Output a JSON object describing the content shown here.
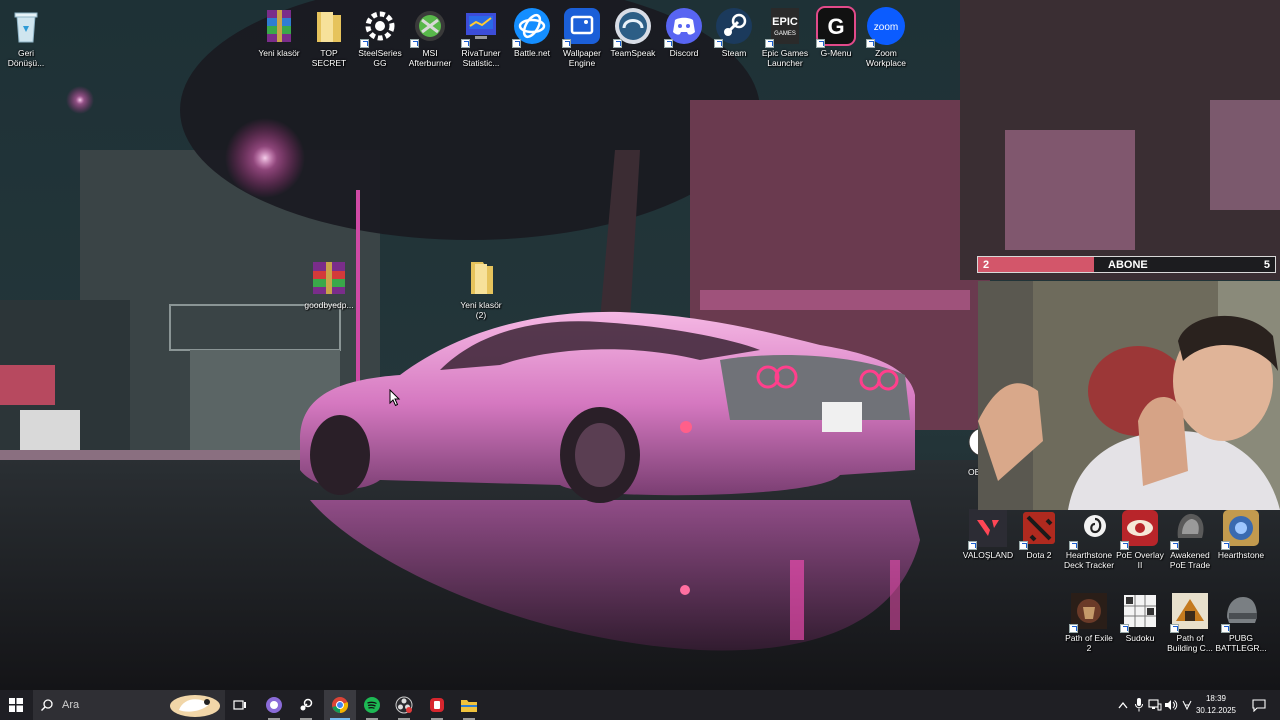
{
  "desktop": {
    "top_icons": [
      {
        "label": "Yeni klasör",
        "icon": "winrar-icon",
        "shortcut": false
      },
      {
        "label": "TOP SECRET",
        "icon": "folder-icon",
        "shortcut": false
      },
      {
        "label": "SteelSeries GG",
        "icon": "steelseries-icon",
        "shortcut": true
      },
      {
        "label": "MSI Afterburner",
        "icon": "afterburner-icon",
        "shortcut": true
      },
      {
        "label": "RivaTuner Statistic...",
        "icon": "rivatuner-icon",
        "shortcut": true
      },
      {
        "label": "Battle.net",
        "icon": "battlenet-icon",
        "shortcut": true
      },
      {
        "label": "Wallpaper Engine",
        "icon": "wallpaper-engine-icon",
        "shortcut": true
      },
      {
        "label": "TeamSpeak",
        "icon": "teamspeak-icon",
        "shortcut": true
      },
      {
        "label": "Discord",
        "icon": "discord-icon",
        "shortcut": true
      },
      {
        "label": "Steam",
        "icon": "steam-icon",
        "shortcut": true
      },
      {
        "label": "Epic Games Launcher",
        "icon": "epic-games-icon",
        "shortcut": true
      },
      {
        "label": "G-Menu",
        "icon": "g-menu-icon",
        "shortcut": true
      },
      {
        "label": "Zoom Workplace",
        "icon": "zoom-icon",
        "shortcut": true
      }
    ],
    "recycle_bin": {
      "label": "Geri Dönüşü...",
      "icon": "recycle-bin-icon"
    },
    "mid_icons": [
      {
        "label": "goodbyedp...",
        "icon": "winrar-icon"
      },
      {
        "label": "Yeni klasör (2)",
        "icon": "folder-icon"
      }
    ],
    "partial_icon": {
      "label": "OB",
      "icon": "obs-icon"
    },
    "game_row_1": [
      {
        "label": "VALOŞLAND",
        "icon": "valorant-icon"
      },
      {
        "label": "Dota 2",
        "icon": "dota2-icon"
      },
      {
        "label": "Hearthstone Deck Tracker",
        "icon": "hearthstone-deck-tracker-icon"
      },
      {
        "label": "PoE Overlay II",
        "icon": "poe-overlay-icon"
      },
      {
        "label": "Awakened PoE Trade",
        "icon": "awakened-poe-icon"
      },
      {
        "label": "Hearthstone",
        "icon": "hearthstone-icon"
      }
    ],
    "game_row_2": [
      {
        "label": "Path of Exile 2",
        "icon": "path-of-exile-icon"
      },
      {
        "label": "Sudoku",
        "icon": "sudoku-icon"
      },
      {
        "label": "Path of Building C...",
        "icon": "path-of-building-icon"
      },
      {
        "label": "PUBG BATTLEGR...",
        "icon": "pubg-icon"
      }
    ]
  },
  "overlay": {
    "start": "2",
    "label": "ABONE",
    "goal": "5",
    "progress": 0.39,
    "fill_color": "#d3566a"
  },
  "taskbar": {
    "search_placeholder": "Ara",
    "apps": [
      {
        "name": "task-view-icon",
        "state": "none"
      },
      {
        "name": "discord-app-icon",
        "state": "running"
      },
      {
        "name": "steam-app-icon",
        "state": "running"
      },
      {
        "name": "chrome-app-icon",
        "state": "active"
      },
      {
        "name": "spotify-app-icon",
        "state": "running"
      },
      {
        "name": "obs-app-icon",
        "state": "running"
      },
      {
        "name": "red-app-icon",
        "state": "running"
      },
      {
        "name": "file-explorer-icon",
        "state": "running"
      }
    ],
    "clock_time": "18:39",
    "clock_date": "30.12.2025"
  }
}
